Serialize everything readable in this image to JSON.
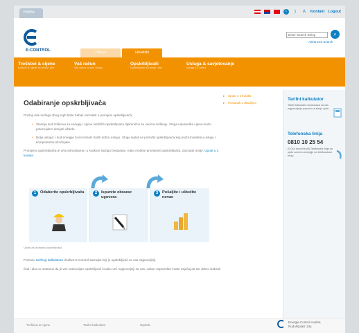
{
  "topbar": {
    "home_tab": "Home",
    "contact": "Kontakt",
    "logout": "Logout"
  },
  "logo": {
    "text": "E-CONTROL"
  },
  "search": {
    "placeholder": "Enter Search String",
    "advanced": "Advanced Search"
  },
  "languages": [
    {
      "label": "Türkçe",
      "active": false
    },
    {
      "label": "Hrvatski",
      "active": true
    }
  ],
  "nav": [
    {
      "title": "Troškovi & cijene",
      "sub": "troškovi & cijene za struju i plin"
    },
    {
      "title": "Vaš račun",
      "sub": "Vaš račun za plin i struju"
    },
    {
      "title": "Opskrbljivači",
      "sub": "Opskrbljivači za struju i plin"
    },
    {
      "title": "Usluga & savjetovanje",
      "sub": "usluga E-Control"
    }
  ],
  "main": {
    "title": "Odabiranje opskrbljivača",
    "intro": "Postoji više razloga zbog kojih biste trebali razmisliti o promjeni opskrbljivača:",
    "bullets": [
      "Štednja kod troškova za energiju: cijene različitih opskrbljivača djelomično se veoma razlikuju. Stoga usporedba cijena može potencijalno donijeti uštede.",
      "Bolja usluga: i kod energije bi se trebalo tražiti dobru uslugu. Stoga isplati se potražiti opskrbljivača koji pruža kvalitetnu uslugu i kompetentne stručnjake."
    ],
    "change_text": "Promjena opskrbljivača je vrlo jednostavna i u svakom slučaju besplatna. Kako možete promijeniti opskrbljivača, doznajte ovdje:",
    "change_link": "Upute u 3 koraka",
    "steps": [
      {
        "num": "1",
        "title": "Odaberite opskrbljivača"
      },
      {
        "num": "2",
        "title": "Ispunite obrazac ugovora"
      },
      {
        "num": "3",
        "title": "Pošaljite i uštedite novac"
      }
    ],
    "caption": "Upute za promjenu opskrbljivača",
    "para2_prefix": "Pomoću",
    "para2_link": "tarifnog kalkulatora",
    "para2_suffix": "društva E-Control saznajte koji je opskrbljivač za vas najpovoljniji.",
    "para3": "Čak i ako ne ustanovi da je već zadovoljan opskrbljivač ionako već najpovoljniji za vas, nakon usporedbe imate osjećaj da ste dobro izabrali."
  },
  "mid_links": [
    "Upute u 3 koraka",
    "Postupak u detaljima"
  ],
  "sidebar": {
    "calc_title": "Tarifni kalkulator",
    "calc_text": "Tarifni kalkulator izračunava za vas najpovoljniju ponudu za struju i plin.",
    "hotline_title": "Telefonska linija",
    "phone": "0810 10 25 54",
    "hotline_text": "(0,044 euro/minuti) Telefonska linija za upite za temu energije na telefonskom broju."
  },
  "footer": {
    "links": [
      "Troškovi & cijene",
      "Tarifni kalkulator",
      "Opskrb."
    ],
    "brand_line1": "Energie-Control Austria",
    "brand_line2": "Rudolfsplatz 13a"
  },
  "colors": {
    "orange": "#f39200",
    "blue": "#0e7fc4"
  }
}
